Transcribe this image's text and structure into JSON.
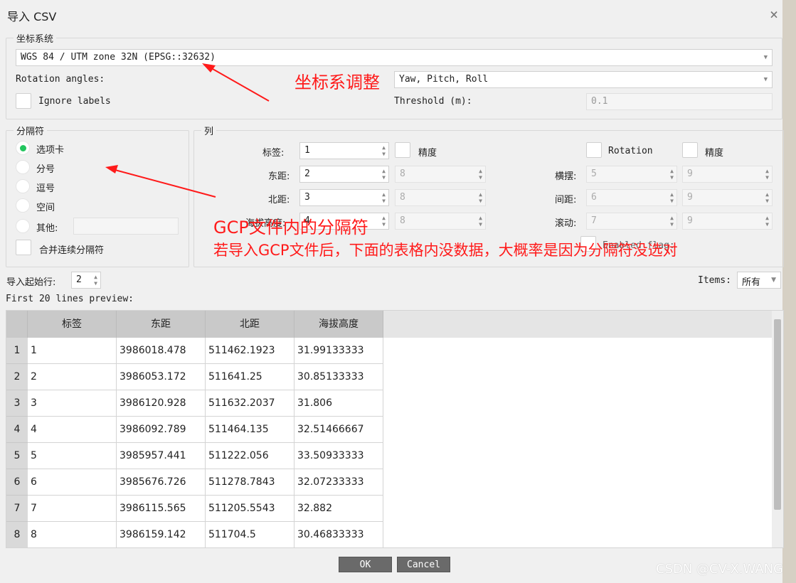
{
  "window": {
    "title": "导入 CSV",
    "close_icon": "×"
  },
  "crs_group": {
    "legend": "坐标系统",
    "crs_value": "WGS 84 / UTM zone 32N (EPSG::32632)",
    "rotation_label": "Rotation angles:",
    "rotation_value": "Yaw, Pitch, Roll",
    "ignore_labels": "Ignore labels",
    "threshold_label": "Threshold (m):",
    "threshold_value": "0.1"
  },
  "separator_group": {
    "legend": "分隔符",
    "options": [
      "选项卡",
      "分号",
      "逗号",
      "空间",
      "其他:"
    ],
    "selected": "选项卡",
    "merge": "合并连续分隔符"
  },
  "columns_group": {
    "legend": "列",
    "label_col": {
      "label": "标签:",
      "value": "1",
      "accuracy": "精度"
    },
    "east": {
      "label": "东距:",
      "value": "2",
      "acc": "8"
    },
    "north": {
      "label": "北距:",
      "value": "3",
      "acc": "8"
    },
    "alt": {
      "label": "海拔高度:",
      "value": "4",
      "acc": "8"
    },
    "rotation": {
      "label": "Rotation",
      "accuracy": "精度"
    },
    "yaw": {
      "label": "横摆:",
      "value": "5",
      "acc": "9"
    },
    "pitch": {
      "label": "间距:",
      "value": "6",
      "acc": "9"
    },
    "roll": {
      "label": "滚动:",
      "value": "7",
      "acc": "9"
    },
    "enabled_flag": "Enabled flag:"
  },
  "start_row": {
    "label": "导入起始行:",
    "value": "2"
  },
  "items": {
    "label": "Items:",
    "value": "所有"
  },
  "preview_label": "First 20 lines preview:",
  "table": {
    "headers": [
      "标签",
      "东距",
      "北距",
      "海拔高度"
    ],
    "rows": [
      [
        "1",
        "1",
        "3986018.478",
        "511462.1923",
        "31.99133333"
      ],
      [
        "2",
        "2",
        "3986053.172",
        "511641.25",
        "30.85133333"
      ],
      [
        "3",
        "3",
        "3986120.928",
        "511632.2037",
        "31.806"
      ],
      [
        "4",
        "4",
        "3986092.789",
        "511464.135",
        "32.51466667"
      ],
      [
        "5",
        "5",
        "3985957.441",
        "511222.056",
        "33.50933333"
      ],
      [
        "6",
        "6",
        "3985676.726",
        "511278.7843",
        "32.07233333"
      ],
      [
        "7",
        "7",
        "3986115.565",
        "511205.5543",
        "32.882"
      ],
      [
        "8",
        "8",
        "3986159.142",
        "511704.5",
        "30.46833333"
      ]
    ]
  },
  "buttons": {
    "ok": "OK",
    "cancel": "Cancel"
  },
  "annotations": {
    "crs_note": "坐标系调整",
    "sep_note": "GCP文件内的分隔符",
    "sep_note2": "若导入GCP文件后，下面的表格内没数据，大概率是因为分隔符没选对"
  },
  "watermark": "CSDN @CV-X.WANG",
  "colors": {
    "annotation": "#ff1a1a",
    "radio_selected": "#22c55e",
    "button_bg": "#6a6a6a"
  }
}
